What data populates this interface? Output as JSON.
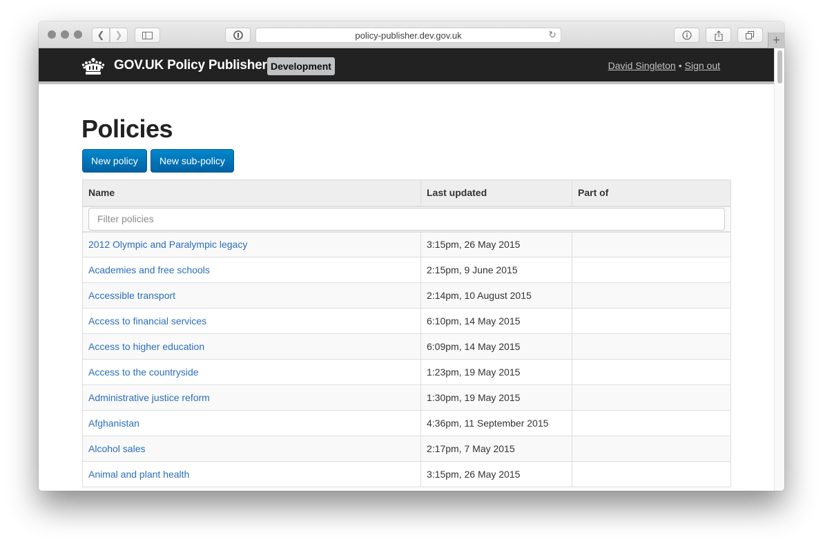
{
  "browser": {
    "url": "policy-publisher.dev.gov.uk",
    "icons": {
      "back": "chevron-left-icon",
      "forward": "chevron-right-icon",
      "sidebar": "sidebar-icon",
      "password": "1password-icon",
      "reload": "reload-icon",
      "info": "info-icon",
      "share": "share-icon",
      "tabs": "tabs-icon",
      "new_tab": "plus-icon"
    }
  },
  "header": {
    "brand": "GOV.UK Policy Publisher",
    "environment": "Development",
    "user_name": "David Singleton",
    "separator": "•",
    "sign_out": "Sign out",
    "colors": {
      "background": "#222222",
      "badge": "#bfc1c3"
    }
  },
  "main": {
    "title": "Policies",
    "buttons": {
      "new_policy": "New policy",
      "new_sub_policy": "New sub-policy"
    },
    "table": {
      "columns": [
        "Name",
        "Last updated",
        "Part of"
      ],
      "filter_placeholder": "Filter policies",
      "filter_value": "",
      "rows": [
        {
          "name": "2012 Olympic and Paralympic legacy",
          "last_updated": "3:15pm, 26 May 2015",
          "part_of": ""
        },
        {
          "name": "Academies and free schools",
          "last_updated": "2:15pm, 9 June 2015",
          "part_of": ""
        },
        {
          "name": "Accessible transport",
          "last_updated": "2:14pm, 10 August 2015",
          "part_of": ""
        },
        {
          "name": "Access to financial services",
          "last_updated": "6:10pm, 14 May 2015",
          "part_of": ""
        },
        {
          "name": "Access to higher education",
          "last_updated": "6:09pm, 14 May 2015",
          "part_of": ""
        },
        {
          "name": "Access to the countryside",
          "last_updated": "1:23pm, 19 May 2015",
          "part_of": ""
        },
        {
          "name": "Administrative justice reform",
          "last_updated": "1:30pm, 19 May 2015",
          "part_of": ""
        },
        {
          "name": "Afghanistan",
          "last_updated": "4:36pm, 11 September 2015",
          "part_of": ""
        },
        {
          "name": "Alcohol sales",
          "last_updated": "2:17pm, 7 May 2015",
          "part_of": ""
        },
        {
          "name": "Animal and plant health",
          "last_updated": "3:15pm, 26 May 2015",
          "part_of": ""
        }
      ]
    },
    "colors": {
      "button": "#0074b8",
      "link": "#2a6ebb"
    }
  }
}
